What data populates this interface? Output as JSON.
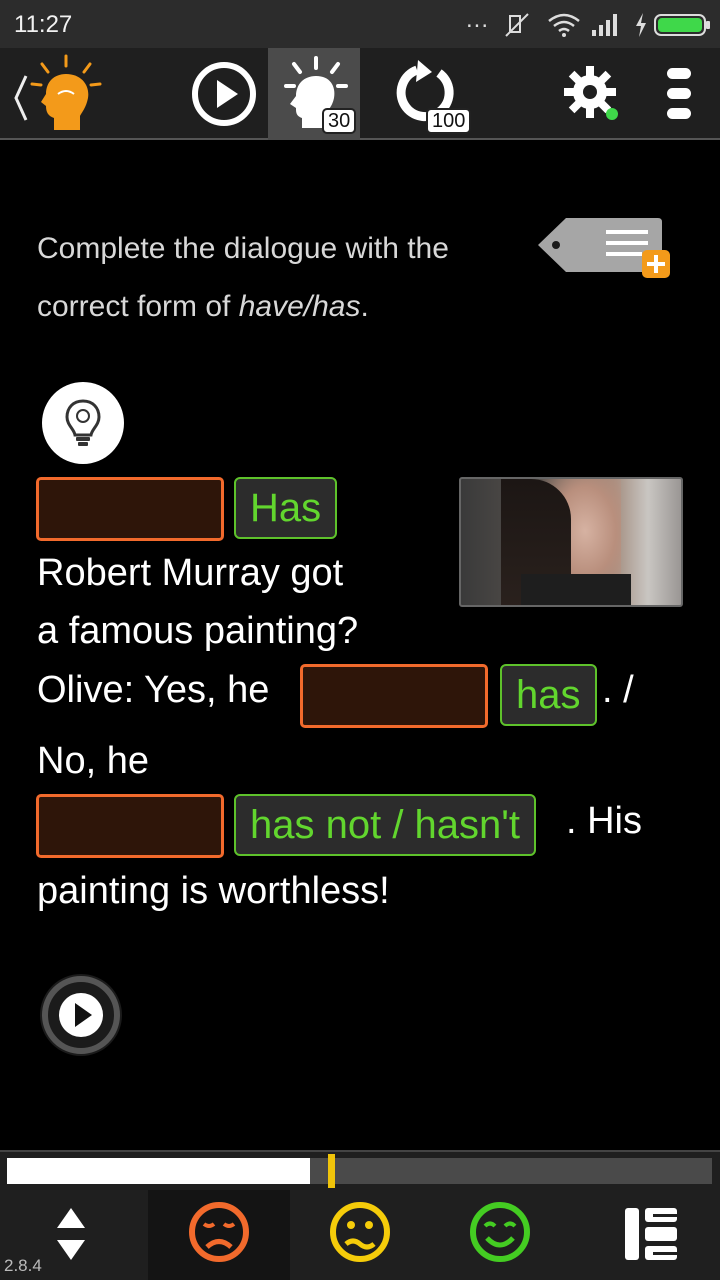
{
  "status_bar": {
    "time": "11:27",
    "dots": "...",
    "icons": [
      "mute-icon",
      "wifi-icon",
      "signal-icon",
      "charging-icon",
      "battery-icon"
    ]
  },
  "toolbar": {
    "back_icon": "chevron-left-icon",
    "logo_icon": "lightbulb-head-logo",
    "play_icon": "play-circle-icon",
    "hints_icon": "thinking-head-icon",
    "hints_count": "30",
    "repeat_icon": "refresh-icon",
    "repeat_count": "100",
    "settings_icon": "gear-icon",
    "menu_icon": "more-vertical-icon"
  },
  "exercise": {
    "instruction_plain": "Complete the dialogue with the correct form of ",
    "instruction_italic": "have/has",
    "instruction_end": ".",
    "add_note_icon": "tag-add-note-icon",
    "hint_icon": "lightbulb-icon",
    "answers": [
      "Has",
      "has",
      "has not / hasn't"
    ],
    "text": {
      "line1": "Robert Murray got",
      "line2": "a famous painting?",
      "line3": "Olive: Yes, he",
      "punct1": ". /",
      "line4": "No, he",
      "punct2": ". His",
      "line5": "painting is worthless!"
    },
    "audio_icon": "play-icon"
  },
  "progress": {
    "fill_fraction": 0.43,
    "marker_fraction": 0.455,
    "colors": {
      "fill": "#ffffff",
      "track": "#4a4a4a",
      "marker": "#f0c40a"
    }
  },
  "bottom_bar": {
    "version": "2.8.4",
    "updown_icon": "up-down-arrows-icon",
    "hard_icon": "frown-face-icon",
    "medium_icon": "neutral-face-icon",
    "easy_icon": "smile-face-icon",
    "list_icon": "list-icon",
    "colors": {
      "hard": "#f26a2c",
      "medium": "#f5cc0a",
      "easy": "#44cc22"
    }
  }
}
